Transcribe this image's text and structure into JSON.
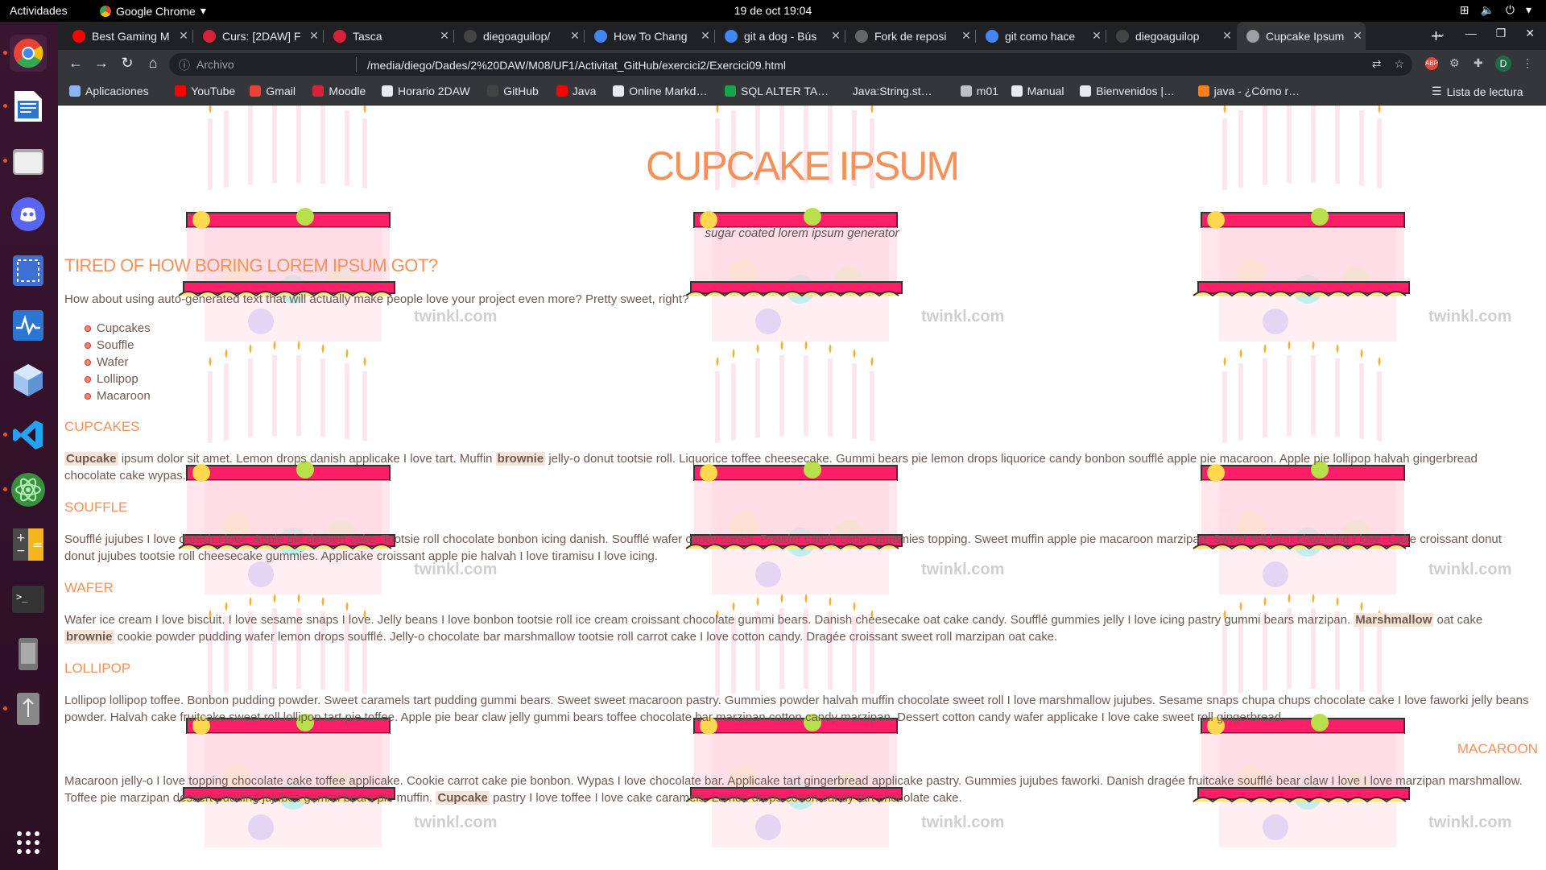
{
  "os": {
    "activities": "Actividades",
    "app_name": "Google Chrome",
    "clock": "19 de oct  19:04"
  },
  "tabs": [
    {
      "title": "Best Gaming M",
      "icon_color": "#ff0000"
    },
    {
      "title": "Curs: [2DAW] F",
      "icon_color": "#d9213a"
    },
    {
      "title": "Tasca",
      "icon_color": "#d9213a"
    },
    {
      "title": "diegoaguilop/",
      "icon_color": "#444444"
    },
    {
      "title": "How To Chang",
      "icon_color": "#4285f4"
    },
    {
      "title": "git a dog - Bús",
      "icon_color": "#4285f4"
    },
    {
      "title": "Fork de reposi",
      "icon_color": "#666666"
    },
    {
      "title": "git como hace",
      "icon_color": "#4285f4"
    },
    {
      "title": "diegoaguilop",
      "icon_color": "#444444"
    },
    {
      "title": "Cupcake Ipsum",
      "icon_color": "#9aa0a6",
      "active": true
    }
  ],
  "toolbar": {
    "security_label": "Archivo",
    "url": "/media/diego/Dades/2%20DAW/M08/UF1/Activitat_GitHub/exercici2/Exercici09.html",
    "profile_initial": "D",
    "abp_label": "ABP"
  },
  "bookmarks": [
    {
      "label": "Aplicaciones",
      "icon": "apps-icon",
      "color": "#8ab4f8"
    },
    {
      "label": "YouTube",
      "icon": "youtube-icon",
      "color": "#ff0000"
    },
    {
      "label": "Gmail",
      "icon": "gmail-icon",
      "color": "#ea4335"
    },
    {
      "label": "Moodle",
      "icon": "moodle-icon",
      "color": "#d9213a"
    },
    {
      "label": "Horario 2DAW",
      "icon": "globe-icon",
      "color": "#e8eaed"
    },
    {
      "label": "GitHub",
      "icon": "github-icon",
      "color": "#444444"
    },
    {
      "label": "Java",
      "icon": "java-icon",
      "color": "#ff0000"
    },
    {
      "label": "Online Markd…",
      "icon": "markdown-icon",
      "color": "#e8eaed"
    },
    {
      "label": "SQL ALTER TA…",
      "icon": "sql-icon",
      "color": "#16a34a"
    },
    {
      "label": "Java:String.st…",
      "icon": "blank-icon",
      "color": "#35363a"
    },
    {
      "label": "m01",
      "icon": "folder-icon",
      "color": "#bdc1c6"
    },
    {
      "label": "Manual",
      "icon": "globe-icon",
      "color": "#e8eaed"
    },
    {
      "label": "Bienvenidos |…",
      "icon": "globe-icon",
      "color": "#e8eaed"
    },
    {
      "label": "java - ¿Cómo r…",
      "icon": "stackoverflow-icon",
      "color": "#f48024"
    }
  ],
  "reading_list": "Lista de lectura",
  "page": {
    "title": "CUPCAKE IPSUM",
    "subtitle": "sugar coated lorem ipsum generator",
    "intro_heading": "TIRED OF HOW BORING LOREM IPSUM GOT?",
    "intro_text": "How about using auto-generated text that will actually make people love your project even more? Pretty sweet, right?",
    "list": [
      "Cupcakes",
      "Souffle",
      "Wafer",
      "Lollipop",
      "Macaroon"
    ],
    "watermark": "twinkl.com",
    "sections": {
      "cupcakes": {
        "heading": "CUPCAKES",
        "hl1": "Cupcake",
        "t1": " ipsum dolor sit amet. Lemon drops danish applicake I love tart. Muffin ",
        "hl2": "brownie",
        "t2": " jelly-o donut tootsie roll. Liquorice toffee cheesecake. Gummi bears pie lemon drops liquorice candy bonbon soufflé apple pie macaroon. Apple pie lollipop halvah gingerbread chocolate cake wypas."
      },
      "souffle": {
        "heading": "SOUFFLE",
        "text": "Soufflé jujubes I love danish I love. Apple pie dessert cake. Tootsie roll chocolate bonbon icing danish. Soufflé wafer candy canes. Powder candy canes gummies topping. Sweet muffin apple pie macaroon marzipan. Sweet roll bear claw icing I love. Cake croissant donut donut jujubes tootsie roll cheesecake gummies. Applicake croissant apple pie halvah I love tiramisu I love icing."
      },
      "wafer": {
        "heading": "WAFER",
        "t1": "Wafer ice cream I love biscuit. I love sesame snaps I love. Jelly beans I love bonbon tootsie roll ice cream croissant chocolate gummi bears. Danish cheesecake oat cake candy. Soufflé gummies jelly I love icing pastry gummi bears marzipan. ",
        "hl1": "Marshmallow",
        "t2": " oat cake ",
        "hl2": "brownie",
        "t3": " cookie powder pudding wafer lemon drops soufflé. Jelly-o chocolate bar marshmallow tootsie roll carrot cake I love cotton candy. Dragée croissant sweet roll marzipan oat cake."
      },
      "lollipop": {
        "heading": "LOLLIPOP",
        "text": "Lollipop lollipop toffee. Bonbon pudding powder. Sweet caramels tart pudding gummi bears. Sweet sweet macaroon pastry. Gummies powder halvah muffin chocolate sweet roll I love marshmallow jujubes. Sesame snaps chupa chups chocolate cake I love faworki jelly beans powder. Halvah cake fruitcake sweet roll lollipop tart pie toffee. Apple pie bear claw jelly gummi bears toffee chocolate bar marzipan cotton candy marzipan. Dessert cotton candy wafer applicake I love cake sweet roll gingerbread."
      },
      "macaroon": {
        "heading": "MACAROON",
        "t1": "Macaroon jelly-o I love topping chocolate cake toffee applicake. Cookie carrot cake pie bonbon. Wypas I love chocolate bar. Applicake tart gingerbread applicake pastry. Gummies jujubes faworki. Danish dragée fruitcake soufflé bear claw I love I love marzipan marshmallow. Toffee pie marzipan dessert pudding jujubes gummi bears pie muffin. ",
        "hl1": "Cupcake",
        "t2": " pastry I love toffee I love cake caramels. Lemon drops cotton candy tart chocolate cake."
      }
    }
  }
}
